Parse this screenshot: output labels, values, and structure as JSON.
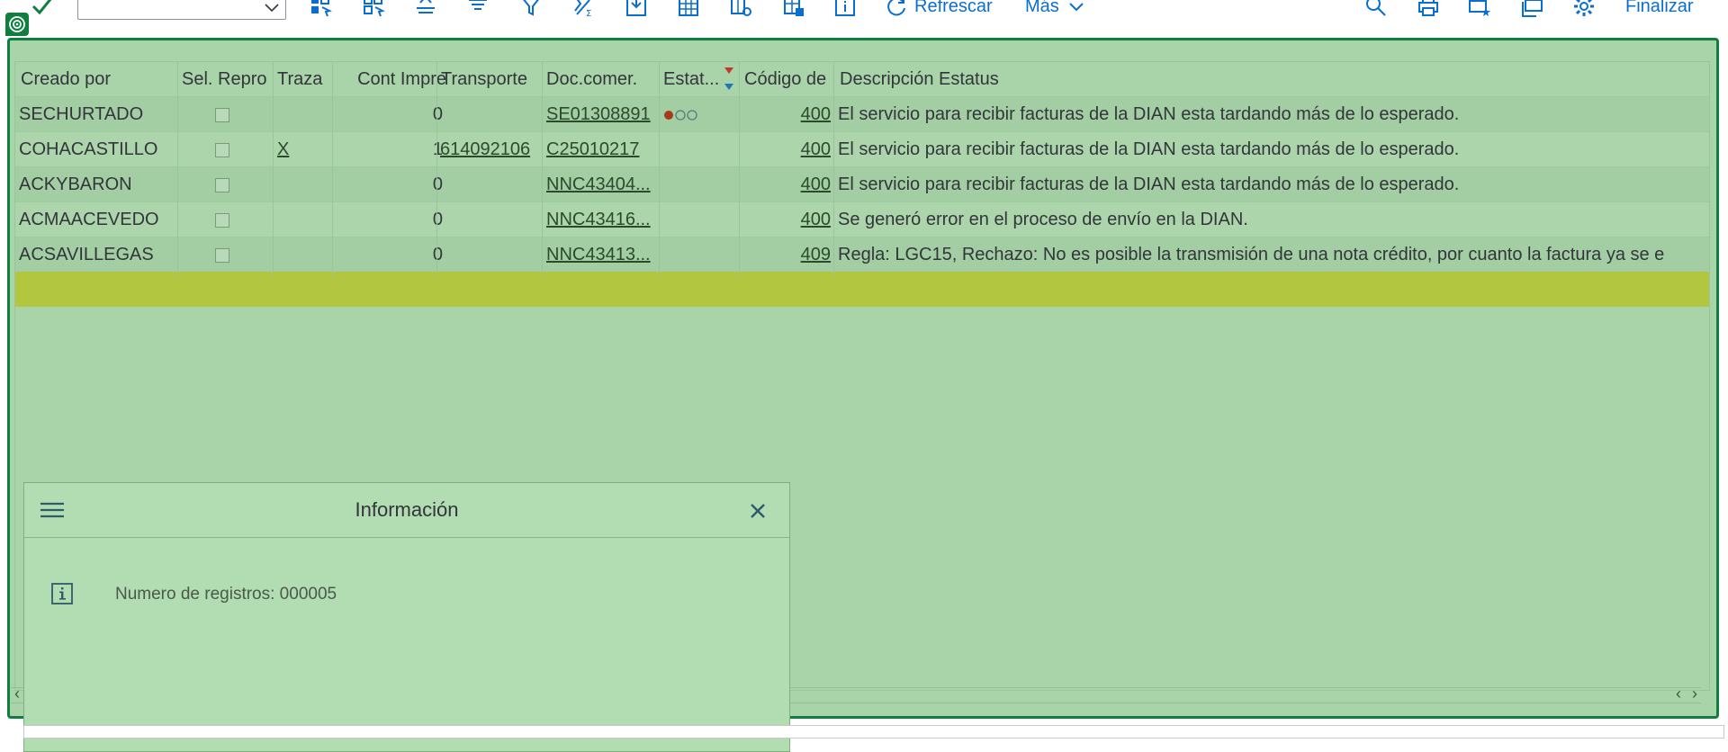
{
  "toolbar": {
    "variant_value": "",
    "refresh_label": "Refrescar",
    "more_label": "Más",
    "finish_label": "Finalizar"
  },
  "table": {
    "columns": [
      "Creado por",
      "Sel. Repro",
      "Traza",
      "Cont Impre",
      "Transporte",
      "Doc.comer.",
      "Estat...",
      "Código de",
      "Descripción Estatus"
    ],
    "rows": [
      {
        "creado": "SECHURTADO",
        "traza": "",
        "cont": "0",
        "transporte": "",
        "doc": "SE01308891",
        "codigo": "400",
        "desc": "El servicio para recibir facturas de la DIAN esta tardando más de lo esperado."
      },
      {
        "creado": "COHACASTILLO",
        "traza": "X",
        "cont": "1",
        "transporte": "614092106",
        "doc": "C25010217",
        "codigo": "400",
        "desc": "El servicio para recibir facturas de la DIAN esta tardando más de lo esperado."
      },
      {
        "creado": "ACKYBARON",
        "traza": "",
        "cont": "0",
        "transporte": "",
        "doc": "NNC43404...",
        "codigo": "400",
        "desc": "El servicio para recibir facturas de la DIAN esta tardando más de lo esperado."
      },
      {
        "creado": "ACMAACEVEDO",
        "traza": "",
        "cont": "0",
        "transporte": "",
        "doc": "NNC43416...",
        "codigo": "400",
        "desc": "Se generó error en el proceso de envío en la DIAN."
      },
      {
        "creado": "ACSAVILLEGAS",
        "traza": "",
        "cont": "0",
        "transporte": "",
        "doc": "NNC43413...",
        "codigo": "409",
        "desc": "Regla: LGC15, Rechazo: No es posible la transmisión de una nota crédito, por cuanto la factura ya se e"
      }
    ]
  },
  "dialog": {
    "title": "Información",
    "message": "Numero de registros: 000005"
  },
  "colors": {
    "frame": "#107e3e",
    "selected_row": "#b3c640",
    "accent": "#0a6ed1"
  }
}
